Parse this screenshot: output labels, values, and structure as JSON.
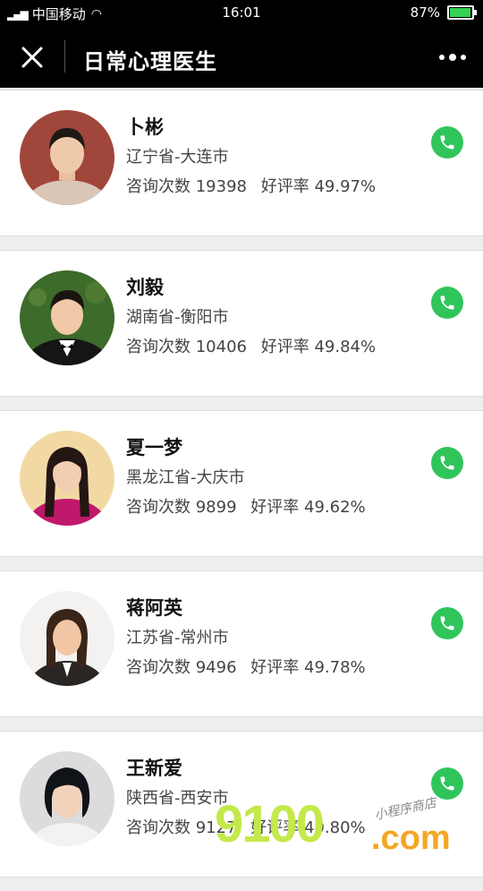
{
  "status_bar": {
    "carrier": "中国移动",
    "time": "16:01",
    "battery_percent": "87%",
    "battery_level": 0.87
  },
  "nav": {
    "title": "日常心理医生",
    "close_icon": "close-icon",
    "more_icon": "more-icon"
  },
  "doctors": [
    {
      "name": "卜彬",
      "location": "辽宁省-大连市",
      "consult_label": "咨询次数",
      "consult_count": "19398",
      "rating_label": "好评率",
      "rating": "49.97%"
    },
    {
      "name": "刘毅",
      "location": "湖南省-衡阳市",
      "consult_label": "咨询次数",
      "consult_count": "10406",
      "rating_label": "好评率",
      "rating": "49.84%"
    },
    {
      "name": "夏一梦",
      "location": "黑龙江省-大庆市",
      "consult_label": "咨询次数",
      "consult_count": "9899",
      "rating_label": "好评率",
      "rating": "49.62%"
    },
    {
      "name": "蒋阿英",
      "location": "江苏省-常州市",
      "consult_label": "咨询次数",
      "consult_count": "9496",
      "rating_label": "好评率",
      "rating": "49.78%"
    },
    {
      "name": "王新爱",
      "location": "陕西省-西安市",
      "consult_label": "咨询次数",
      "consult_count": "9127",
      "rating_label": "好评率",
      "rating": "49.80%"
    }
  ],
  "watermark": {
    "main": "9100",
    "domain": ".com",
    "sub": "小程序商店"
  },
  "colors": {
    "call_button": "#2fc55b",
    "nav_background": "#000000",
    "battery_fill": "#36d256"
  }
}
